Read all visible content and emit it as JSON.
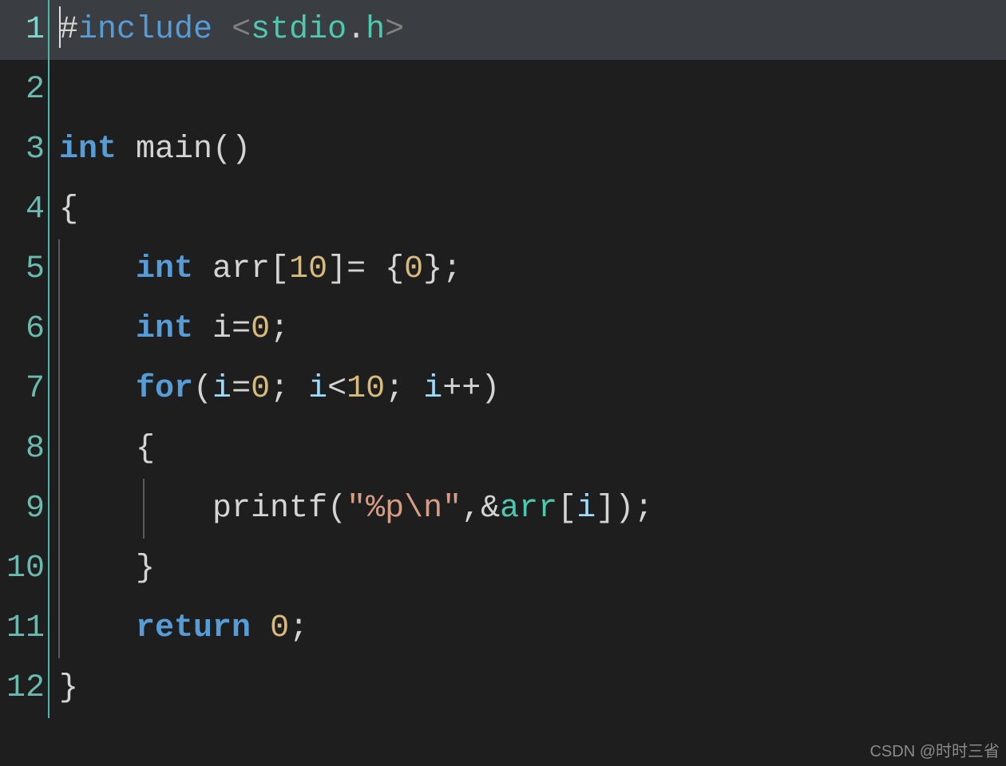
{
  "watermark": "CSDN @时时三省",
  "line_numbers": [
    "1",
    "2",
    "3",
    "4",
    "5",
    "6",
    "7",
    "8",
    "9",
    "10",
    "11",
    "12"
  ],
  "tokens": {
    "hash": "#",
    "include": "include",
    "lt": "<",
    "gt": ">",
    "stdio": "stdio",
    "dot": ".",
    "h": "h",
    "int": "int",
    "main": "main",
    "lparen": "(",
    "rparen": ")",
    "lbrace": "{",
    "rbrace": "}",
    "arr": "arr",
    "lbracket": "[",
    "rbracket": "]",
    "ten": "10",
    "eq": "=",
    "zero": "0",
    "semi": ";",
    "i": "i",
    "for": "for",
    "ltop": "<",
    "plusplus": "++",
    "printf": "printf",
    "str_open": "\"",
    "str_pct": "%p",
    "str_nl": "\\n",
    "str_close": "\"",
    "comma": ",",
    "amp": "&",
    "return": "return",
    "sp": " ",
    "sp4": "    ",
    "sp8": "        "
  }
}
